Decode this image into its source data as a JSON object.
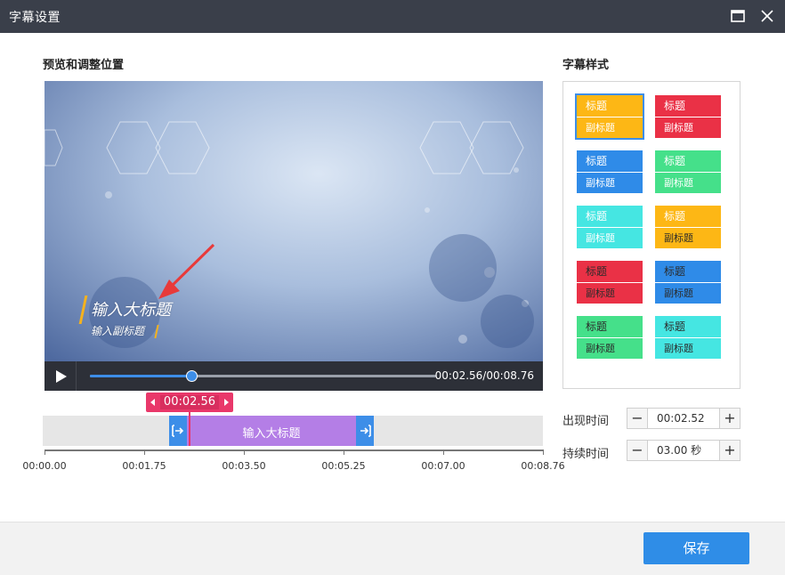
{
  "window": {
    "title": "字幕设置"
  },
  "preview": {
    "heading": "预览和调整位置",
    "caption_title": "输入大标题",
    "caption_subtitle": "输入副标题",
    "time_display": "00:02.56/00:08.76",
    "progress_fraction": 0.292
  },
  "timeline": {
    "current_time": "00:02.56",
    "clip_label": "输入大标题",
    "ticks": [
      "00:00.00",
      "00:01.75",
      "00:03.50",
      "00:05.25",
      "00:07.00",
      "00:08.76"
    ]
  },
  "styles": {
    "heading": "字幕样式",
    "items": [
      {
        "title": "标题",
        "subtitle": "副标题",
        "top_color": "#fdb715",
        "bottom_color": "#fdb715",
        "selected": true
      },
      {
        "title": "标题",
        "subtitle": "副标题",
        "top_color": "#ea3146",
        "bottom_color": "#ea3146"
      },
      {
        "title": "标题",
        "subtitle": "副标题",
        "top_color": "#2f8be8",
        "bottom_color": "#2f8be8"
      },
      {
        "title": "标题",
        "subtitle": "副标题",
        "top_color": "#45e08a",
        "bottom_color": "#45e08a"
      },
      {
        "title": "标题",
        "subtitle": "副标题",
        "top_color": "#45e6e2",
        "bottom_color": "#45e6e2"
      },
      {
        "title": "标题",
        "subtitle": "副标题",
        "top_color": "#fdb715",
        "bottom_color": "#fdb715",
        "dark_sub": true
      },
      {
        "title": "标题",
        "subtitle": "副标题",
        "top_color": "#ea3146",
        "bottom_color": "#ea3146",
        "dark_title": true
      },
      {
        "title": "标题",
        "subtitle": "副标题",
        "top_color": "#2f8be8",
        "bottom_color": "#2f8be8",
        "dark_title": true
      },
      {
        "title": "标题",
        "subtitle": "副标题",
        "top_color": "#45e08a",
        "bottom_color": "#45e08a",
        "dark_title": true
      },
      {
        "title": "标题",
        "subtitle": "副标题",
        "top_color": "#45e6e2",
        "bottom_color": "#45e6e2",
        "dark_title": true
      }
    ]
  },
  "timing": {
    "appear_label": "出现时间",
    "appear_value": "00:02.52",
    "duration_label": "持续时间",
    "duration_value": "03.00 秒",
    "minus": "−",
    "plus": "+"
  },
  "footer": {
    "save_label": "保存"
  },
  "colors": {
    "accent": "#2f8de7",
    "tag": "#e9386a",
    "clip": "#b47ee6"
  }
}
